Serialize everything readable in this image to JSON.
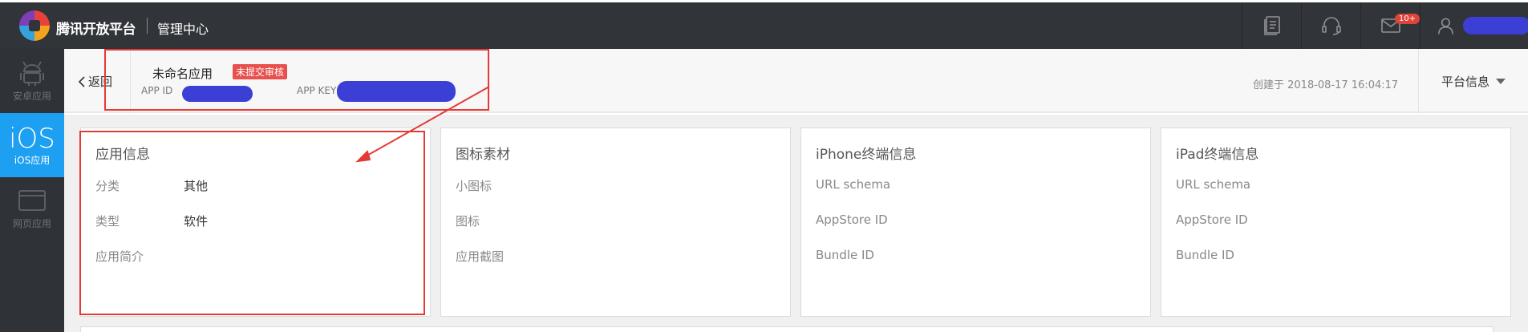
{
  "header": {
    "brand": "腾讯开放平台",
    "section": "管理中心",
    "notification_badge": "10+"
  },
  "sidebar": {
    "items": [
      {
        "label": "安卓应用",
        "icon": "android-icon"
      },
      {
        "label": "iOS应用",
        "glyph": "iOS",
        "active": true
      },
      {
        "label": "网页应用",
        "icon": "web-window-icon"
      }
    ]
  },
  "subheader": {
    "back_label": "返回",
    "app_name": "未命名应用",
    "status_tag": "未提交审核",
    "app_id_label": "APP ID",
    "app_key_label": "APP KEY",
    "created": "创建于 2018-08-17 16:04:17",
    "platform_label": "平台信息"
  },
  "cards": [
    {
      "title": "应用信息",
      "rows": [
        {
          "label": "分类",
          "value": "其他"
        },
        {
          "label": "类型",
          "value": "软件"
        },
        {
          "label": "应用简介",
          "value": ""
        }
      ]
    },
    {
      "title": "图标素材",
      "rows": [
        {
          "label": "小图标"
        },
        {
          "label": "图标"
        },
        {
          "label": "应用截图"
        }
      ]
    },
    {
      "title": "iPhone终端信息",
      "rows": [
        {
          "label": "URL schema"
        },
        {
          "label": "AppStore ID"
        },
        {
          "label": "Bundle ID"
        }
      ]
    },
    {
      "title": "iPad终端信息",
      "rows": [
        {
          "label": "URL schema"
        },
        {
          "label": "AppStore ID"
        },
        {
          "label": "Bundle ID"
        }
      ]
    }
  ],
  "colors": {
    "topbar": "#313438",
    "sidebar": "#2f3236",
    "active": "#1d9ff2",
    "tag": "#e8504d",
    "annotation": "#e53935",
    "redaction": "#3c3fd6"
  }
}
